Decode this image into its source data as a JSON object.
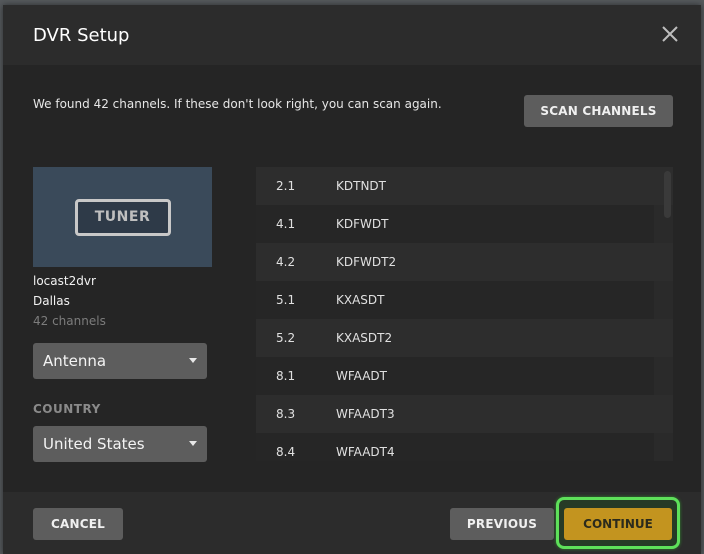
{
  "modal": {
    "title": "DVR Setup",
    "close_icon": "close-icon"
  },
  "body": {
    "found_message": "We found 42 channels. If these don't look right, you can scan again.",
    "scan_button": "SCAN CHANNELS"
  },
  "device": {
    "badge": "TUNER",
    "name": "locast2dvr",
    "city": "Dallas",
    "channel_count": "42 channels",
    "source_select": {
      "value": "Antenna"
    },
    "country_label": "COUNTRY",
    "country_select": {
      "value": "United States"
    }
  },
  "channels": [
    {
      "number": "2.1",
      "callsign": "KDTNDT"
    },
    {
      "number": "4.1",
      "callsign": "KDFWDT"
    },
    {
      "number": "4.2",
      "callsign": "KDFWDT2"
    },
    {
      "number": "5.1",
      "callsign": "KXASDT"
    },
    {
      "number": "5.2",
      "callsign": "KXASDT2"
    },
    {
      "number": "8.1",
      "callsign": "WFAADT"
    },
    {
      "number": "8.3",
      "callsign": "WFAADT3"
    },
    {
      "number": "8.4",
      "callsign": "WFAADT4"
    }
  ],
  "footer": {
    "cancel": "CANCEL",
    "previous": "PREVIOUS",
    "continue": "CONTINUE"
  },
  "colors": {
    "accent": "#c3941f",
    "focus_ring": "#5ee05a",
    "tuner_card": "#3a4a5a"
  }
}
